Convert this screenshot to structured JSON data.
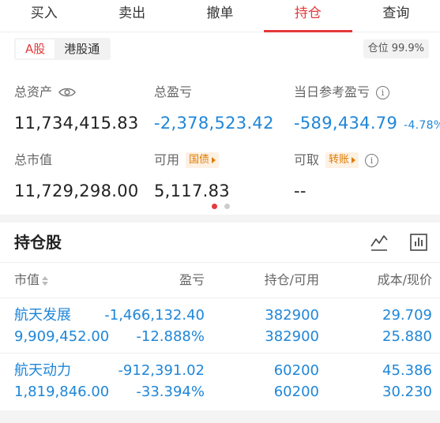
{
  "tabs": [
    "买入",
    "卖出",
    "撤单",
    "持仓",
    "查询"
  ],
  "active_tab": "持仓",
  "market": {
    "options": [
      "A股",
      "港股通"
    ],
    "active": "A股"
  },
  "position_ratio": {
    "label": "仓位",
    "value": "99.9%"
  },
  "summary": {
    "total_assets": {
      "label": "总资产",
      "value": "11,734,415.83",
      "icon": "eye-icon"
    },
    "total_pl": {
      "label": "总盈亏",
      "value": "-2,378,523.42"
    },
    "daily_pl": {
      "label": "当日参考盈亏",
      "value": "-589,434.79",
      "pct": "-4.78%",
      "icon": "info-icon"
    },
    "market_value": {
      "label": "总市值",
      "value": "11,729,298.00"
    },
    "available": {
      "label": "可用",
      "value": "5,117.83",
      "tag": "国债"
    },
    "withdrawable": {
      "label": "可取",
      "value": "--",
      "tag": "转账",
      "icon": "info-icon"
    }
  },
  "pager": {
    "pages": 2,
    "current": 1
  },
  "holdings": {
    "title": "持仓股",
    "columns": [
      "市值",
      "盈亏",
      "持仓/可用",
      "成本/现价"
    ],
    "rows": [
      {
        "name": "航天发展",
        "market_value": "9,909,452.00",
        "pl": "-1,466,132.40",
        "pl_pct": "-12.888%",
        "holding": "382900",
        "available": "382900",
        "cost": "29.709",
        "price": "25.880"
      },
      {
        "name": "航天动力",
        "market_value": "1,819,846.00",
        "pl": "-912,391.02",
        "pl_pct": "-33.394%",
        "holding": "60200",
        "available": "60200",
        "cost": "45.386",
        "price": "30.230"
      }
    ]
  },
  "colors": {
    "accent_red": "#e4393c",
    "loss_blue": "#1f86d8",
    "tag_orange": "#e07b00"
  }
}
